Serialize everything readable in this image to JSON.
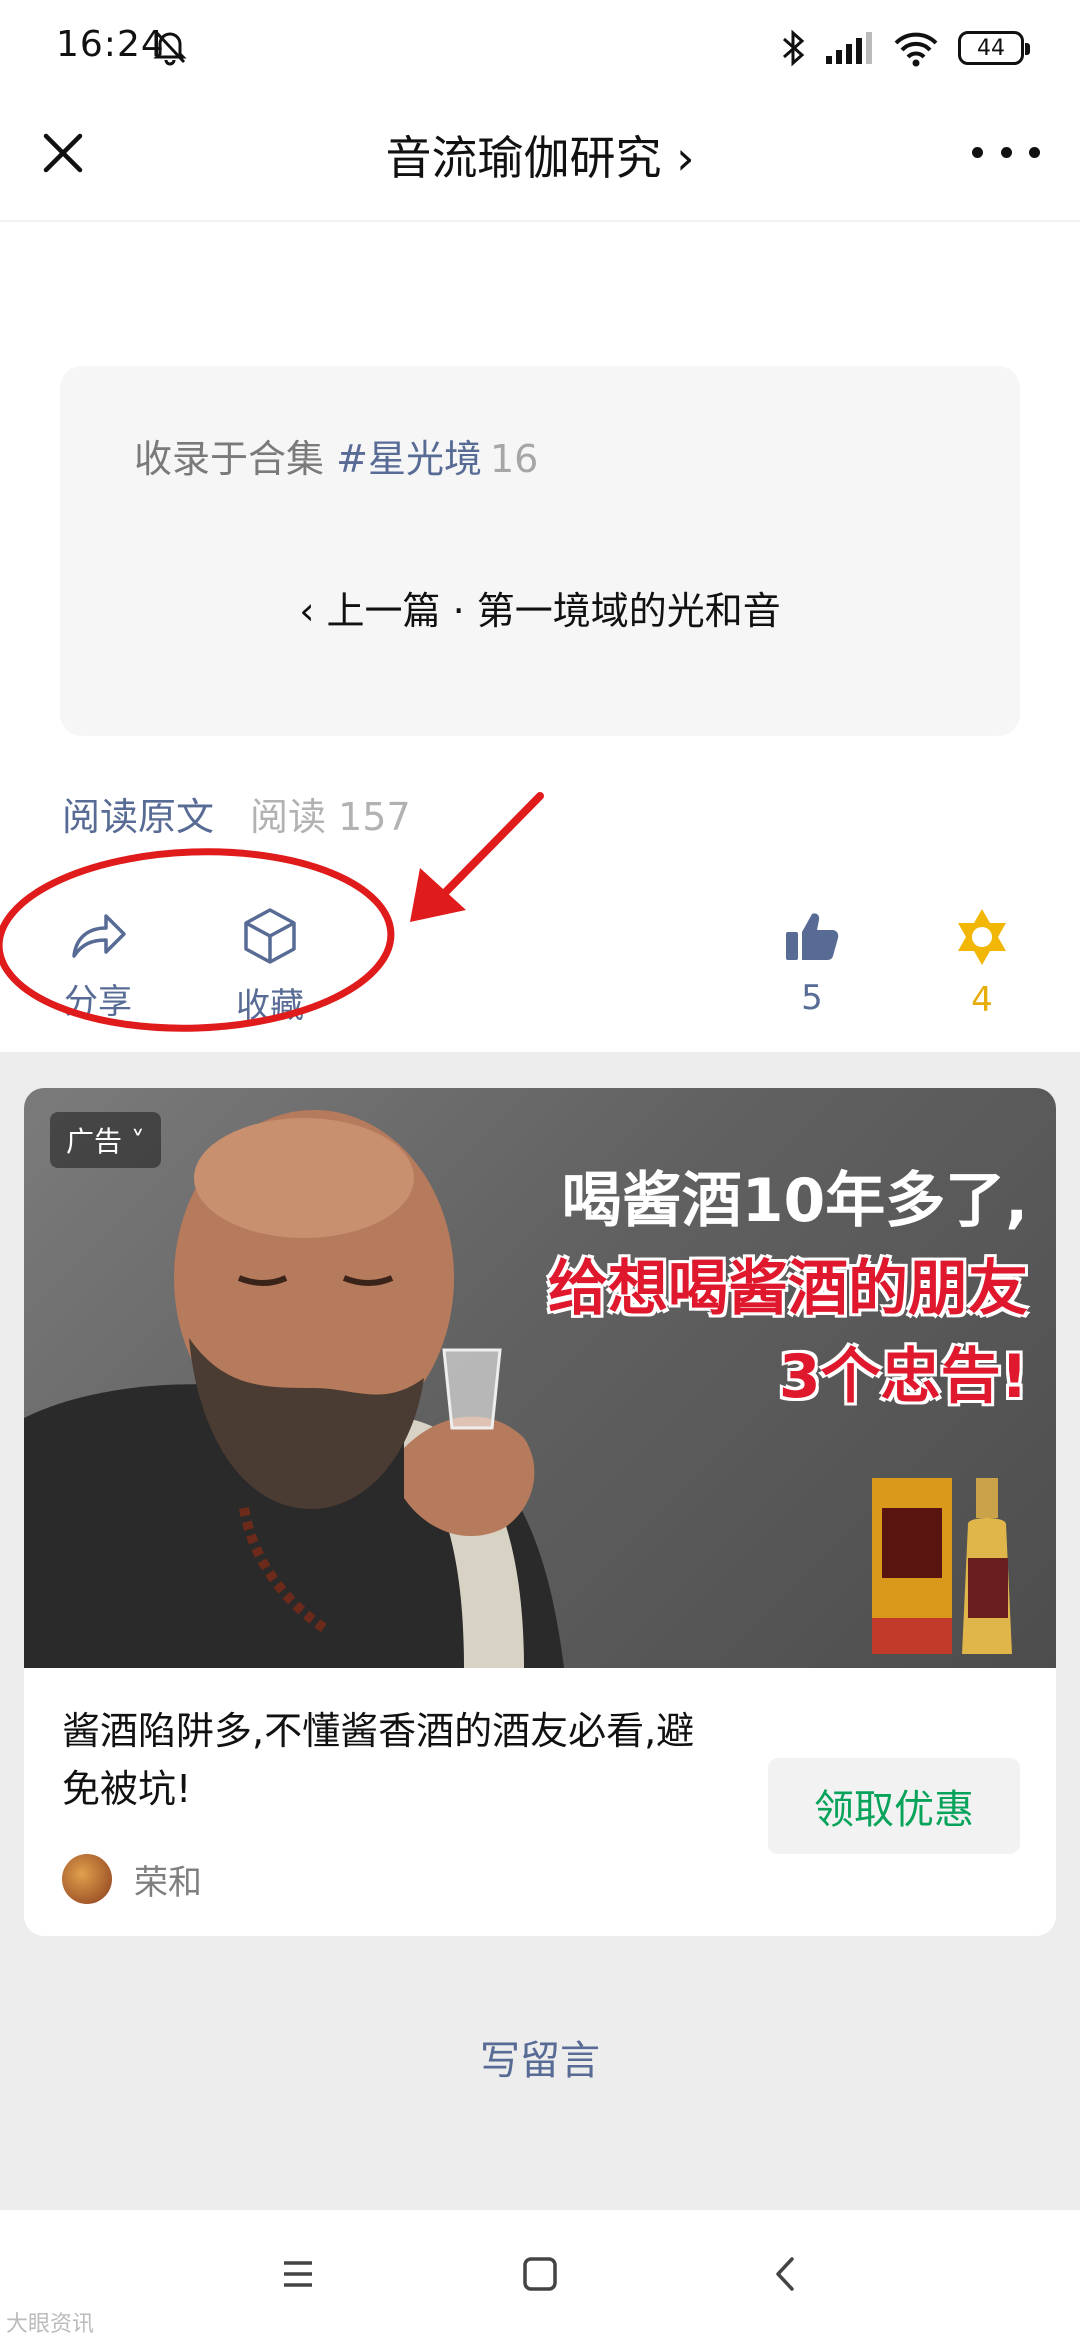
{
  "status_bar": {
    "time": "16:24",
    "battery": "44"
  },
  "header": {
    "title": "音流瑜伽研究 ›"
  },
  "collection": {
    "prefix": "收录于合集",
    "tag": "#星光境",
    "count": "16",
    "prev_article": "‹ 上一篇 · 第一境域的光和音"
  },
  "meta": {
    "read_original": "阅读原文",
    "reads": "阅读 157"
  },
  "actions": {
    "share": "分享",
    "favorite": "收藏",
    "like_count": "5",
    "wow_count": "4"
  },
  "ad": {
    "badge": "广告 ˅",
    "headline_1": "喝酱酒10年多了,",
    "headline_2": "给想喝酱酒的朋友",
    "headline_3": "3个忠告!",
    "description": "酱酒陷阱多,不懂酱香酒的酒友必看,避免被坑!",
    "brand": "荣和",
    "cta": "领取优惠"
  },
  "comment": {
    "label": "写留言"
  },
  "watermark": "大眼资讯",
  "colors": {
    "link": "#576b95",
    "accent_green": "#07a35a",
    "wow_yellow": "#f2b705",
    "annotation_red": "#e01b1b"
  }
}
